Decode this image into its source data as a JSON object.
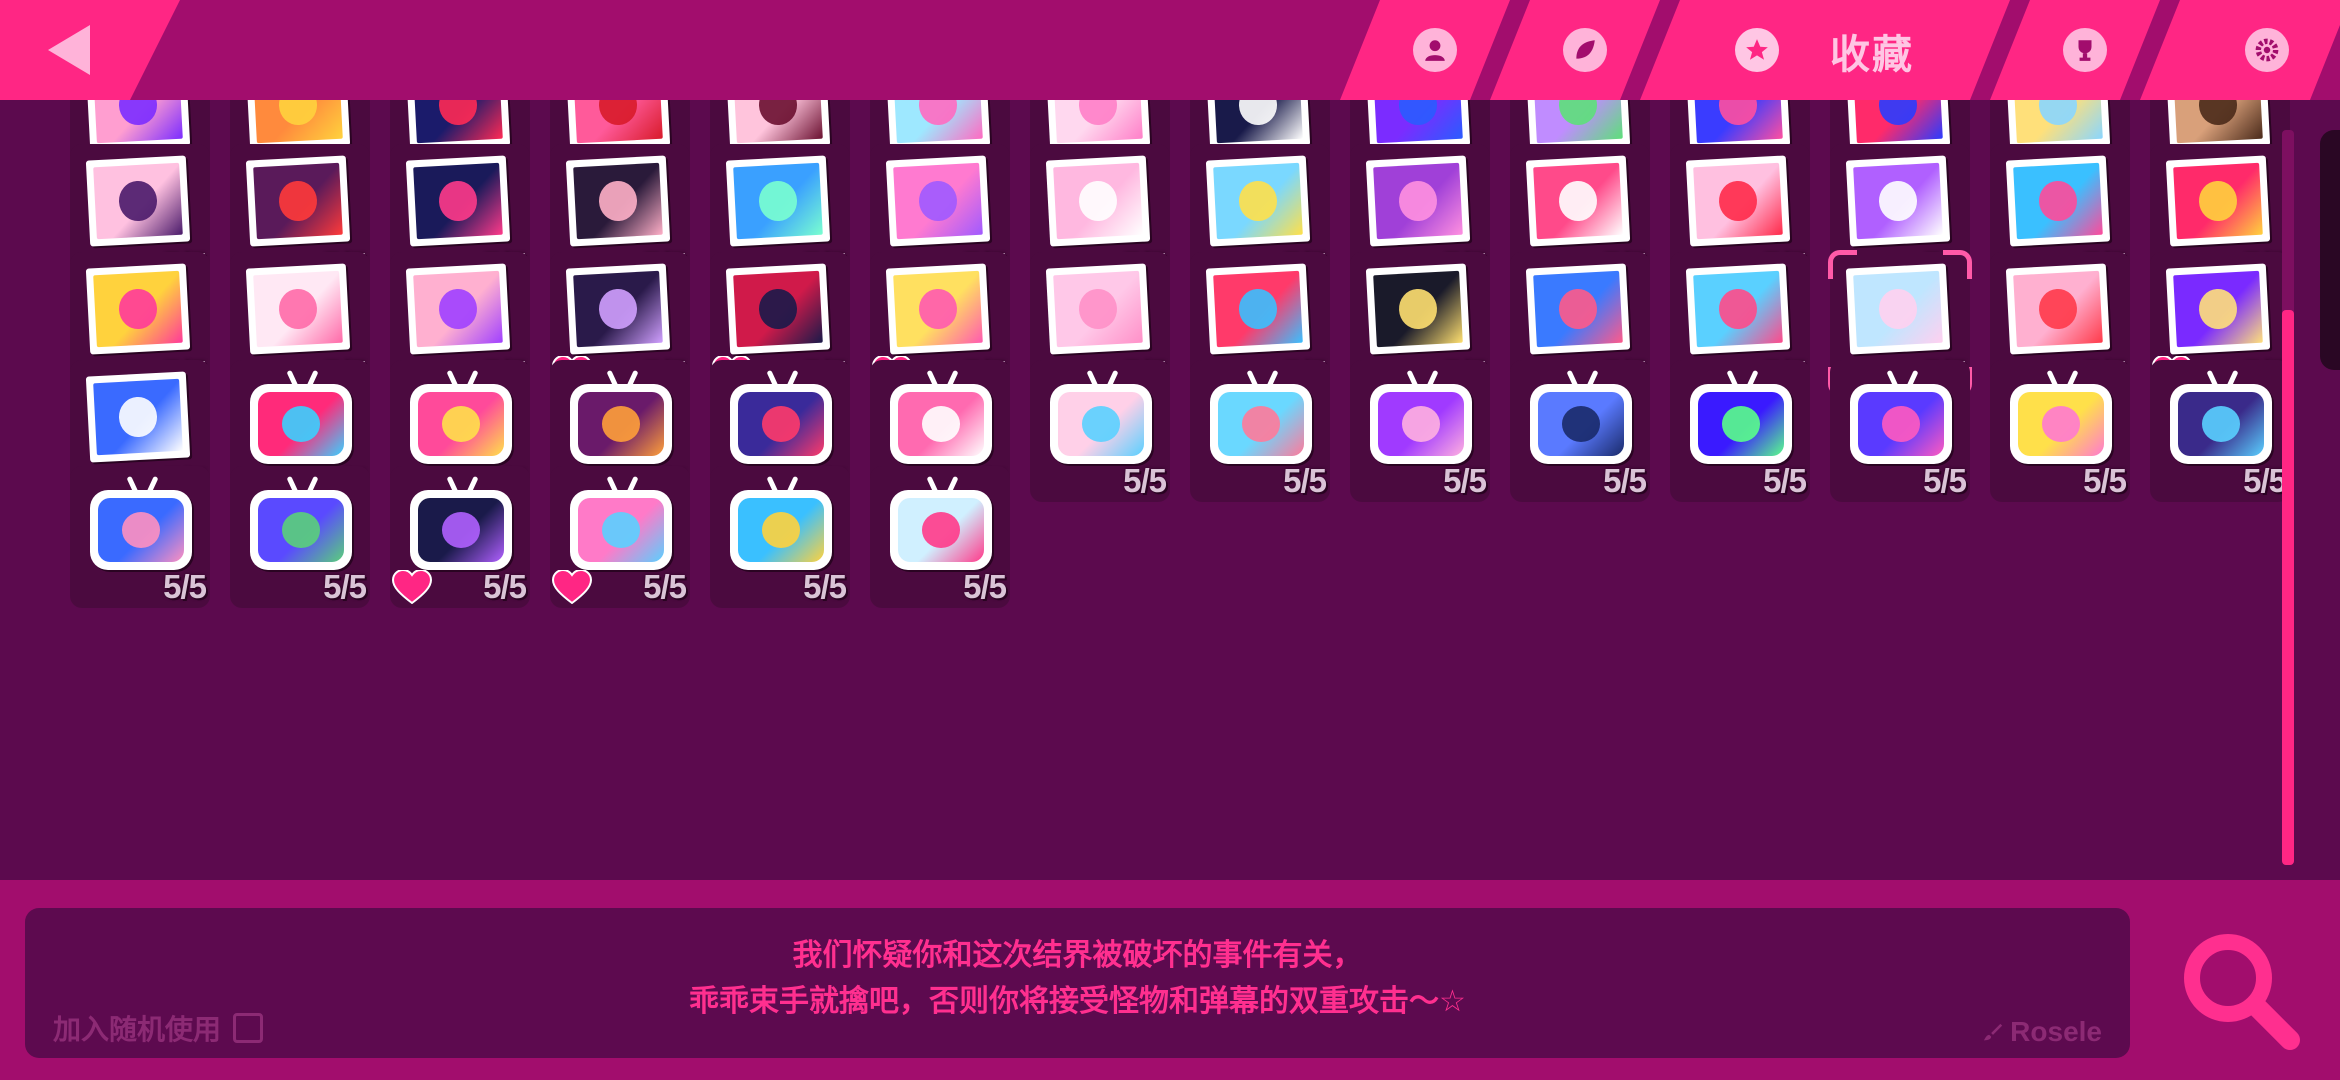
{
  "header": {
    "tabs": [
      {
        "id": "profile",
        "icon": "person-icon",
        "label": ""
      },
      {
        "id": "leaf",
        "icon": "leaf-icon",
        "label": ""
      },
      {
        "id": "collection",
        "icon": "star-icon",
        "label": "收藏",
        "active": true
      },
      {
        "id": "trophy",
        "icon": "trophy-icon",
        "label": ""
      },
      {
        "id": "settings",
        "icon": "gear-icon",
        "label": ""
      }
    ]
  },
  "collection": {
    "rows": [
      {
        "kind": "card",
        "items": [
          {
            "count": "5/5",
            "bg": "#ff9ed0",
            "fg": "#7b2cff",
            "heart": false
          },
          {
            "count": "5/5",
            "bg": "#ff8a3d",
            "fg": "#ffd23d",
            "heart": false
          },
          {
            "count": "5/5",
            "bg": "#1b1b6b",
            "fg": "#ff2a55",
            "heart": false
          },
          {
            "count": "5/5",
            "bg": "#ff5a9a",
            "fg": "#d81b2a",
            "heart": false
          },
          {
            "count": "5/5",
            "bg": "#ffc4dc",
            "fg": "#6a1030",
            "heart": false
          },
          {
            "count": "5/5",
            "bg": "#9ee8ff",
            "fg": "#ff6ac1",
            "heart": false
          },
          {
            "count": "5/5",
            "bg": "#ffd8ef",
            "fg": "#ff7fc8",
            "heart": false
          },
          {
            "count": "5/5",
            "bg": "#191a4a",
            "fg": "#ffffff",
            "heart": false
          },
          {
            "count": "5/5",
            "bg": "#7b2cff",
            "fg": "#2a5cff",
            "heart": false
          },
          {
            "count": "5/5",
            "bg": "#c08cff",
            "fg": "#5de07a",
            "heart": false
          },
          {
            "count": "5/5",
            "bg": "#3a3cff",
            "fg": "#ff4fa0",
            "heart": false
          },
          {
            "count": "5/5",
            "bg": "#ff2a6a",
            "fg": "#2a3cff",
            "heart": false
          },
          {
            "count": "5/5",
            "bg": "#ffe07a",
            "fg": "#8ad6ff",
            "heart": false
          },
          {
            "count": "5/5",
            "bg": "#d9a07a",
            "fg": "#4a2a1a",
            "heart": false
          }
        ]
      },
      {
        "kind": "card",
        "items": [
          {
            "count": "5/5",
            "bg": "#ffc1e0",
            "fg": "#4a1a6a",
            "heart": false
          },
          {
            "count": "5/5",
            "bg": "#5a1a5a",
            "fg": "#ff3a3a",
            "heart": false
          },
          {
            "count": "5/5",
            "bg": "#1a1a5a",
            "fg": "#ff3a8a",
            "heart": false
          },
          {
            "count": "5/5",
            "bg": "#2a1a3a",
            "fg": "#ffb0c8",
            "heart": false
          },
          {
            "count": "5/5",
            "bg": "#3aa0ff",
            "fg": "#7affd0",
            "heart": false
          },
          {
            "count": "5/5",
            "bg": "#ff7ad0",
            "fg": "#a05aff",
            "heart": false
          },
          {
            "count": "5/5",
            "bg": "#ffb8e0",
            "fg": "#ffffff",
            "heart": false
          },
          {
            "count": "5/5",
            "bg": "#7ad8ff",
            "fg": "#ffe04a",
            "heart": false
          },
          {
            "count": "5/5",
            "bg": "#a040d8",
            "fg": "#ff90e0",
            "heart": false
          },
          {
            "count": "5/5",
            "bg": "#ff4a8a",
            "fg": "#ffffff",
            "heart": false
          },
          {
            "count": "5/5",
            "bg": "#ffc0e0",
            "fg": "#ff2a4a",
            "heart": false
          },
          {
            "count": "5/5",
            "bg": "#b060ff",
            "fg": "#ffffff",
            "heart": false
          },
          {
            "count": "5/5",
            "bg": "#3ac0ff",
            "fg": "#ff4a9a",
            "heart": false
          },
          {
            "count": "5/5",
            "bg": "#ff2a6a",
            "fg": "#ffd23d",
            "heart": false
          }
        ]
      },
      {
        "kind": "card",
        "items": [
          {
            "count": "5/5",
            "bg": "#ffd23d",
            "fg": "#ff3a9a",
            "heart": false
          },
          {
            "count": "5/5",
            "bg": "#ffe8f4",
            "fg": "#ff6aa8",
            "heart": false
          },
          {
            "count": "5/5",
            "bg": "#ffb0d0",
            "fg": "#a040ff",
            "heart": false
          },
          {
            "count": "5/5",
            "bg": "#2a1a4a",
            "fg": "#d0a0ff",
            "heart": true
          },
          {
            "count": "5/5",
            "bg": "#d01a4a",
            "fg": "#1a1a4a",
            "heart": true
          },
          {
            "count": "5/5",
            "bg": "#ffe060",
            "fg": "#ff5ab0",
            "heart": true
          },
          {
            "count": "5/5",
            "bg": "#ffc8e8",
            "fg": "#ff90c8",
            "heart": false
          },
          {
            "count": "5/5",
            "bg": "#ff3a6a",
            "fg": "#3ac0ff",
            "heart": false
          },
          {
            "count": "5/5",
            "bg": "#1a1a2a",
            "fg": "#ffe070",
            "heart": false
          },
          {
            "count": "5/5",
            "bg": "#3a7aff",
            "fg": "#ff5a8a",
            "heart": false
          },
          {
            "count": "5/5",
            "bg": "#5ad0ff",
            "fg": "#ff4a8a",
            "heart": false
          },
          {
            "count": "5/5",
            "bg": "#bfe6ff",
            "fg": "#ffd0f0",
            "heart": false,
            "selected": true
          },
          {
            "count": "5/5",
            "bg": "#ffb0d0",
            "fg": "#ff3a4a",
            "heart": false
          },
          {
            "count": "5/5",
            "bg": "#7a2aff",
            "fg": "#ffe07a",
            "heart": true
          }
        ]
      },
      {
        "kind": "tv",
        "items": [
          {
            "count": "5/5",
            "bg": "#3a6aff",
            "fg": "#ffffff",
            "heart": false,
            "plain": true
          },
          {
            "count": "5/5",
            "bg": "#ff2a7a",
            "fg": "#3ad0ff",
            "heart": false
          },
          {
            "count": "5/5",
            "bg": "#ff4a9a",
            "fg": "#ffe04a",
            "heart": false
          },
          {
            "count": "5/5",
            "bg": "#6a1a6a",
            "fg": "#ffa03a",
            "heart": false
          },
          {
            "count": "5/5",
            "bg": "#3a2a9a",
            "fg": "#ff3a6a",
            "heart": false
          },
          {
            "count": "5/5",
            "bg": "#ff6ab0",
            "fg": "#ffffff",
            "heart": false
          },
          {
            "count": "5/5",
            "bg": "#ffd0e8",
            "fg": "#5ad0ff",
            "heart": false
          },
          {
            "count": "5/5",
            "bg": "#6ad8ff",
            "fg": "#ff7a9a",
            "heart": false
          },
          {
            "count": "5/5",
            "bg": "#a03aff",
            "fg": "#ffb0e0",
            "heart": false
          },
          {
            "count": "5/5",
            "bg": "#5a7aff",
            "fg": "#1a2a6a",
            "heart": false
          },
          {
            "count": "5/5",
            "bg": "#3a1aff",
            "fg": "#5aff8a",
            "heart": false
          },
          {
            "count": "5/5",
            "bg": "#5a3aff",
            "fg": "#ff5ac0",
            "heart": false
          },
          {
            "count": "5/5",
            "bg": "#ffe04a",
            "fg": "#ff7ad0",
            "heart": false
          },
          {
            "count": "5/5",
            "bg": "#3a2a8a",
            "fg": "#5ad0ff",
            "heart": false
          }
        ]
      },
      {
        "kind": "tv",
        "items": [
          {
            "count": "5/5",
            "bg": "#3a6aff",
            "fg": "#ff90c0",
            "heart": false
          },
          {
            "count": "5/5",
            "bg": "#5a4aff",
            "fg": "#5ad07a",
            "heart": false
          },
          {
            "count": "5/5",
            "bg": "#1a1a4a",
            "fg": "#b060ff",
            "heart": true
          },
          {
            "count": "5/5",
            "bg": "#ff7ac8",
            "fg": "#5ad0ff",
            "heart": true
          },
          {
            "count": "5/5",
            "bg": "#3ac0ff",
            "fg": "#ffd23d",
            "heart": false
          },
          {
            "count": "5/5",
            "bg": "#d0f0ff",
            "fg": "#ff3a8a",
            "heart": false
          }
        ]
      }
    ]
  },
  "scrollbar": {
    "position": 0.35,
    "visible_fraction": 0.3
  },
  "description": {
    "line1": "我们怀疑你和这次结界被破坏的事件有关，",
    "line2": "乖乖束手就擒吧，否则你将接受怪物和弹幕的双重攻击〜☆"
  },
  "random_option": {
    "label": "加入随机使用",
    "checked": false
  },
  "author": {
    "label": "Rosele"
  },
  "colors": {
    "accent": "#ff2684",
    "panel": "#a20d6d",
    "bg": "#5c0a4e"
  }
}
